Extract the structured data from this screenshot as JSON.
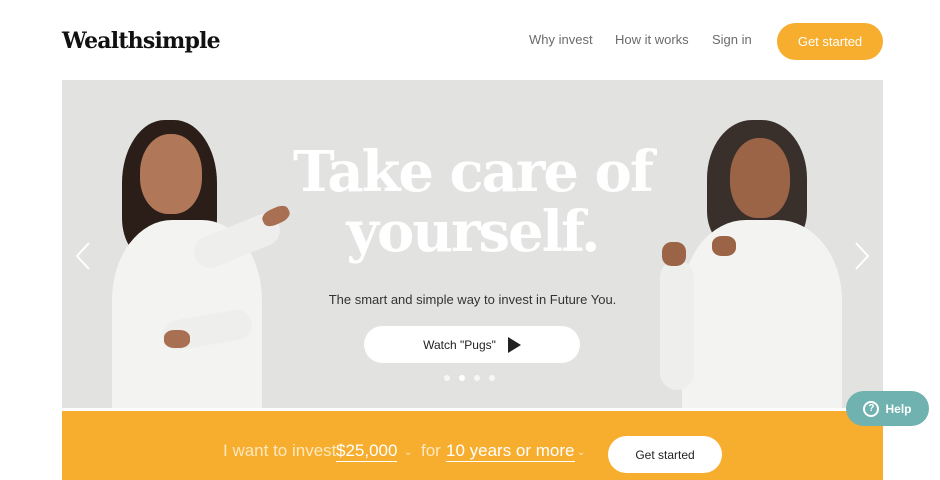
{
  "header": {
    "logo": "Wealthsimple",
    "nav": [
      "Why invest",
      "How it works",
      "Sign in"
    ],
    "cta": "Get started"
  },
  "hero": {
    "title_line1": "Take care of",
    "title_line2": "yourself.",
    "subtitle": "The smart and simple way to invest in Future You.",
    "watch_label": "Watch \"Pugs\"",
    "slide_count": 4,
    "active_slide": 2
  },
  "bar": {
    "text1": "I want to invest",
    "amount": "$25,000",
    "text2": "for",
    "period": "10 years or more",
    "cta": "Get started"
  },
  "help": {
    "label": "Help"
  },
  "colors": {
    "accent": "#f7ae2f",
    "hero_bg": "#e2e3e1",
    "help": "#6fb2b0"
  }
}
